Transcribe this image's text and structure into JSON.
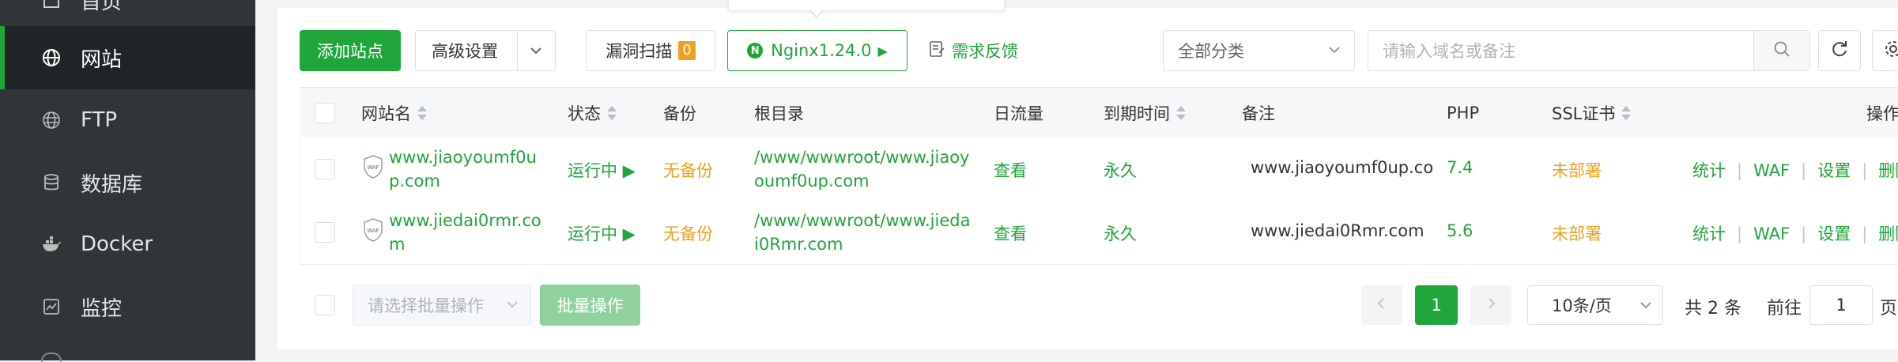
{
  "sidebar": {
    "items": [
      {
        "label": "首页",
        "icon": "home-icon"
      },
      {
        "label": "网站",
        "icon": "globe-icon",
        "active": true
      },
      {
        "label": "FTP",
        "icon": "ftp-globe-icon"
      },
      {
        "label": "数据库",
        "icon": "database-icon"
      },
      {
        "label": "Docker",
        "icon": "docker-icon"
      },
      {
        "label": "监控",
        "icon": "monitor-icon"
      }
    ]
  },
  "toolbar": {
    "add_site": "添加站点",
    "advanced": "高级设置",
    "vuln_scan": "漏洞扫描",
    "vuln_count": "0",
    "nginx_version": "Nginx1.24.0",
    "nginx_badge": "N",
    "feedback": "需求反馈",
    "category_select": "全部分类",
    "search_placeholder": "请输入域名或备注"
  },
  "table": {
    "columns": [
      "网站名",
      "状态",
      "备份",
      "根目录",
      "日流量",
      "到期时间",
      "备注",
      "PHP",
      "SSL证书",
      "操作"
    ],
    "rows": [
      {
        "name_line1": "www.jiaoyoumf0u",
        "name_line2": "p.com",
        "status": "运行中 ▶",
        "backup": "无备份",
        "root_line1": "/www/wwwroot/www.jiaoy",
        "root_line2": "oumf0up.com",
        "traffic": "查看",
        "expire": "永久",
        "note": "www.jiaoyoumf0up.co",
        "php": "7.4",
        "ssl": "未部署",
        "ops": [
          "统计",
          "WAF",
          "设置",
          "删除"
        ]
      },
      {
        "name_line1": "www.jiedai0rmr.co",
        "name_line2": "m",
        "status": "运行中 ▶",
        "backup": "无备份",
        "root_line1": "/www/wwwroot/www.jieda",
        "root_line2": "i0Rmr.com",
        "traffic": "查看",
        "expire": "永久",
        "note": "www.jiedai0Rmr.com",
        "php": "5.6",
        "ssl": "未部署",
        "ops": [
          "统计",
          "WAF",
          "设置",
          "删除"
        ]
      }
    ],
    "waf_label": "WAF"
  },
  "footer": {
    "batch_placeholder": "请选择批量操作",
    "batch_button": "批量操作",
    "current_page": "1",
    "page_size": "10条/页",
    "total": "共 2 条",
    "goto_label": "前往",
    "goto_value": "1",
    "page_suffix": "页"
  },
  "colors": {
    "accent": "#20a53a",
    "warning": "#f0a020",
    "sidebar_bg": "#303538"
  }
}
